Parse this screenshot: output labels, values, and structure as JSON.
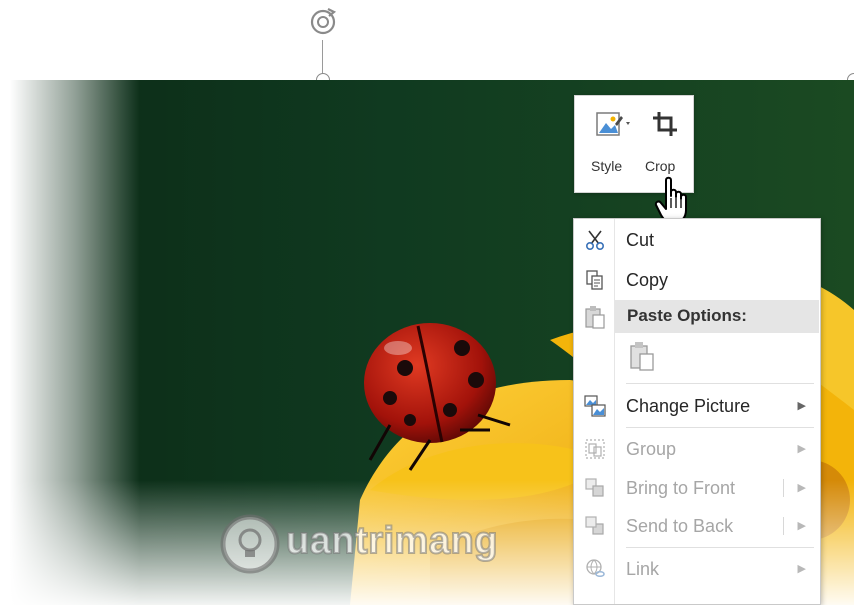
{
  "mini_toolbar": {
    "style_label": "Style",
    "crop_label": "Crop"
  },
  "context_menu": {
    "cut": "Cut",
    "copy": "Copy",
    "paste_options": "Paste Options:",
    "change_picture": "Change Picture",
    "group": "Group",
    "bring_to_front": "Bring to Front",
    "send_to_back": "Send to Back",
    "link": "Link"
  },
  "watermark": {
    "text": "uantrimang"
  },
  "colors": {
    "background_green": "#10361f",
    "petal_yellow": "#f5b400",
    "ladybug_red": "#b3140b",
    "menu_highlight": "#e5e5e5"
  }
}
